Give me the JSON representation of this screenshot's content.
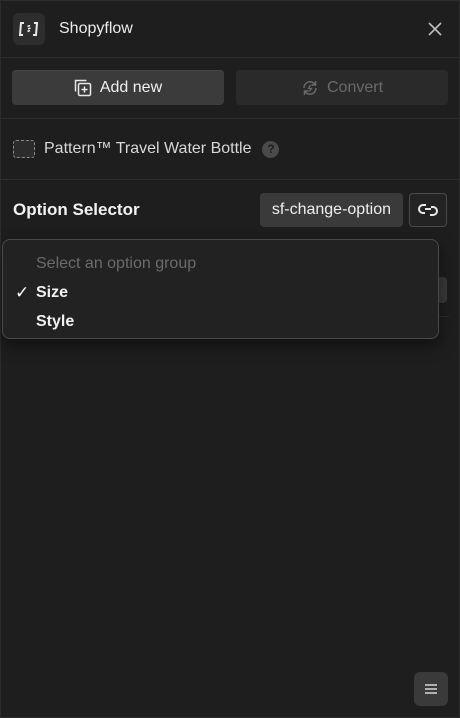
{
  "header": {
    "title": "Shopyflow",
    "logo_icon": "shopyflow-logo-icon",
    "close_icon": "close-icon"
  },
  "actions": {
    "add_new_label": "Add new",
    "convert_label": "Convert"
  },
  "element": {
    "name": "Pattern™ Travel Water Bottle",
    "help_icon_text": "?"
  },
  "option_selector": {
    "label": "Option Selector",
    "attribute": "sf-change-option"
  },
  "dropdown": {
    "placeholder": "Select an option group",
    "options": [
      {
        "label": "Size",
        "selected": true
      },
      {
        "label": "Style",
        "selected": false
      }
    ],
    "check_glyph": "✓"
  },
  "colors": {
    "background": "#1e1e1e",
    "button": "#3b3b3b",
    "text": "#e6e6e6",
    "muted": "#6b6b6b"
  }
}
